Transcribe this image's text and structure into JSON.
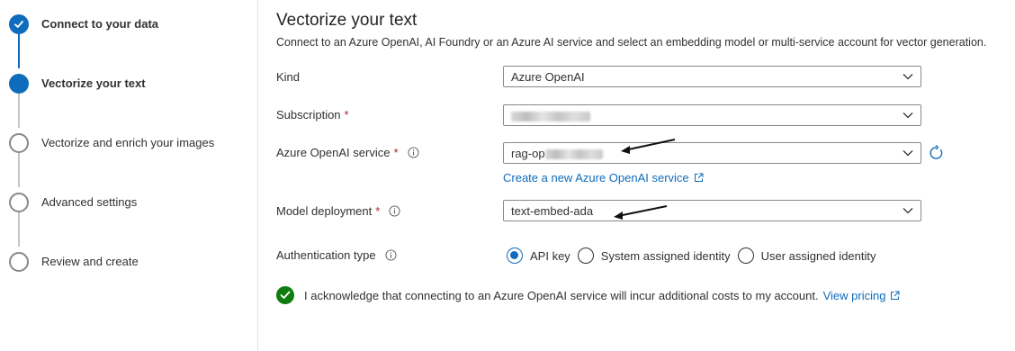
{
  "stepper": {
    "steps": [
      {
        "label": "Connect to your data",
        "state": "done"
      },
      {
        "label": "Vectorize your text",
        "state": "current"
      },
      {
        "label": "Vectorize and enrich your images",
        "state": "todo"
      },
      {
        "label": "Advanced settings",
        "state": "todo"
      },
      {
        "label": "Review and create",
        "state": "todo"
      }
    ]
  },
  "main": {
    "title": "Vectorize your text",
    "description": "Connect to an Azure OpenAI, AI Foundry or an Azure AI service and select an embedding model or multi-service account for vector generation.",
    "kind": {
      "label": "Kind",
      "value": "Azure OpenAI"
    },
    "subscription": {
      "label": "Subscription",
      "required_mark": "*"
    },
    "service": {
      "label": "Azure OpenAI service",
      "required_mark": "*",
      "value_prefix": "rag-op",
      "create_link": "Create a new Azure OpenAI service"
    },
    "model": {
      "label": "Model deployment",
      "required_mark": "*",
      "value": "text-embed-ada"
    },
    "auth": {
      "label": "Authentication type",
      "options": [
        "API key",
        "System assigned identity",
        "User assigned identity"
      ],
      "selected": "API key"
    },
    "acknowledge": {
      "text": "I acknowledge that connecting to an Azure OpenAI service will incur additional costs to my account.",
      "link": "View pricing",
      "checked": true
    }
  },
  "colors": {
    "accent": "#0f6cbd",
    "success": "#107c10",
    "required": "#a4262c"
  },
  "icons": [
    "checkmark-icon",
    "info-icon",
    "chevron-down-icon",
    "refresh-icon",
    "external-link-icon"
  ]
}
